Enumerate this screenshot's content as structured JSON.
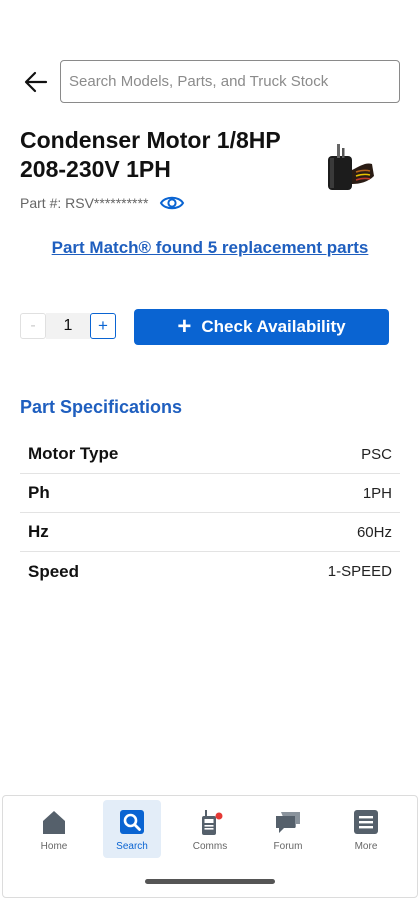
{
  "search": {
    "placeholder": "Search Models, Parts, and Truck Stock"
  },
  "product": {
    "title": "Condenser Motor 1/8HP 208-230V 1PH",
    "part_number": "Part #: RSV**********"
  },
  "part_match": {
    "label": "Part Match® found 5 replacement parts"
  },
  "quantity": {
    "minus": "-",
    "value": "1",
    "plus": "+"
  },
  "check_availability": {
    "icon": "+",
    "label": "Check Availability"
  },
  "specs": {
    "heading": "Part Specifications",
    "rows": [
      {
        "name": "Motor Type",
        "value": "PSC"
      },
      {
        "name": "Ph",
        "value": "1PH"
      },
      {
        "name": "Hz",
        "value": "60Hz"
      },
      {
        "name": "Speed",
        "value": "1-SPEED"
      }
    ]
  },
  "nav": {
    "items": [
      {
        "label": "Home",
        "icon": "home-icon"
      },
      {
        "label": "Search",
        "icon": "search-icon",
        "active": true
      },
      {
        "label": "Comms",
        "icon": "walkie-talkie-icon"
      },
      {
        "label": "Forum",
        "icon": "chat-bubbles-icon"
      },
      {
        "label": "More",
        "icon": "menu-icon"
      }
    ]
  },
  "colors": {
    "accent": "#0a64d2",
    "link": "#1f5fbf",
    "nav_active_bg": "#e3edf8",
    "notification_dot": "#e53935"
  }
}
